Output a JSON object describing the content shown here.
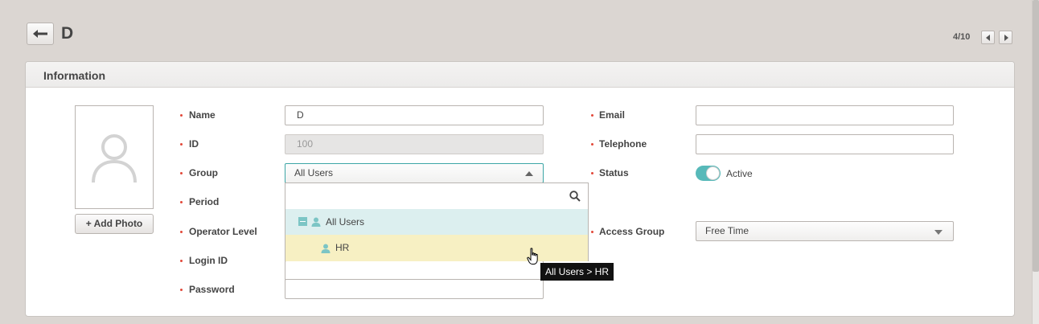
{
  "header": {
    "title": "D",
    "pager": {
      "text": "4/10"
    }
  },
  "panel": {
    "title": "Information",
    "photo": {
      "button_label": "+ Add Photo"
    }
  },
  "fields": {
    "name": {
      "label": "Name",
      "value": "D"
    },
    "id": {
      "label": "ID",
      "value": "100"
    },
    "group": {
      "label": "Group",
      "value": "All Users"
    },
    "period": {
      "label": "Period"
    },
    "operator_level": {
      "label": "Operator Level"
    },
    "login_id": {
      "label": "Login ID",
      "value": ""
    },
    "password": {
      "label": "Password",
      "value": ""
    },
    "email": {
      "label": "Email",
      "value": ""
    },
    "telephone": {
      "label": "Telephone",
      "value": ""
    },
    "status": {
      "label": "Status",
      "toggle_text": "Active",
      "on": true
    },
    "access_group": {
      "label": "Access Group",
      "value": "Free Time"
    }
  },
  "group_dropdown": {
    "search_value": "",
    "items": [
      {
        "label": "All Users"
      },
      {
        "label": "HR"
      }
    ],
    "tooltip": "All Users > HR"
  },
  "colors": {
    "accent": "#57b9b9",
    "required_dot": "#e2493a",
    "selected_row": "#dcefef",
    "hover_row": "#f7f0c3"
  }
}
